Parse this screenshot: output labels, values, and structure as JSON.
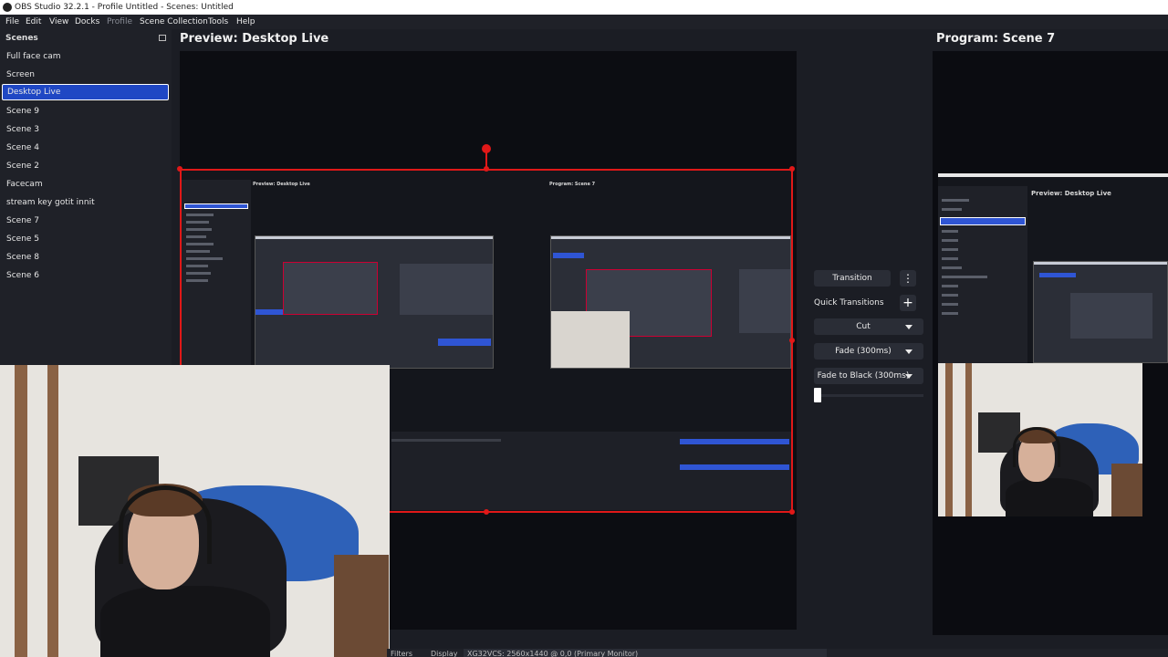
{
  "window": {
    "title": "OBS Studio 32.2.1 - Profile Untitled - Scenes: Untitled"
  },
  "menu": {
    "items": [
      "File",
      "Edit",
      "View",
      "Docks",
      "Profile",
      "Scene Collection",
      "Tools",
      "Help"
    ]
  },
  "scenes": {
    "header": "Scenes",
    "items": [
      "Full face cam",
      "Screen",
      "Desktop Live",
      "Scene 9",
      "Scene 3",
      "Scene 4",
      "Scene 2",
      "Facecam",
      "stream key gotit innit",
      "Scene 7",
      "Scene 5",
      "Scene 8",
      "Scene 6"
    ],
    "selected": "Desktop Live"
  },
  "preview": {
    "title": "Preview: Desktop Live"
  },
  "program": {
    "title": "Program: Scene 7"
  },
  "transitions": {
    "transition_button": "Transition",
    "quick_label": "Quick Transitions",
    "quick_items": [
      "Cut",
      "Fade (300ms)",
      "Fade to Black (300ms)"
    ],
    "tbar_value": 0.0
  },
  "nested": {
    "preview_title": "Preview: Desktop Live",
    "program_title": "Program: Scene 7"
  },
  "bottom": {
    "filters_label": "Filters",
    "display_label": "Display",
    "display_value": "XG32VCS: 2560x1440 @ 0,0 (Primary Monitor)"
  },
  "colors": {
    "accent": "#1f47c4",
    "selection_outline": "#e01818",
    "background": "#1b1d24"
  },
  "icons": [
    "obs-logo-icon",
    "float-dock-icon",
    "more-vertical-icon",
    "add-icon",
    "chevron-down-icon"
  ]
}
